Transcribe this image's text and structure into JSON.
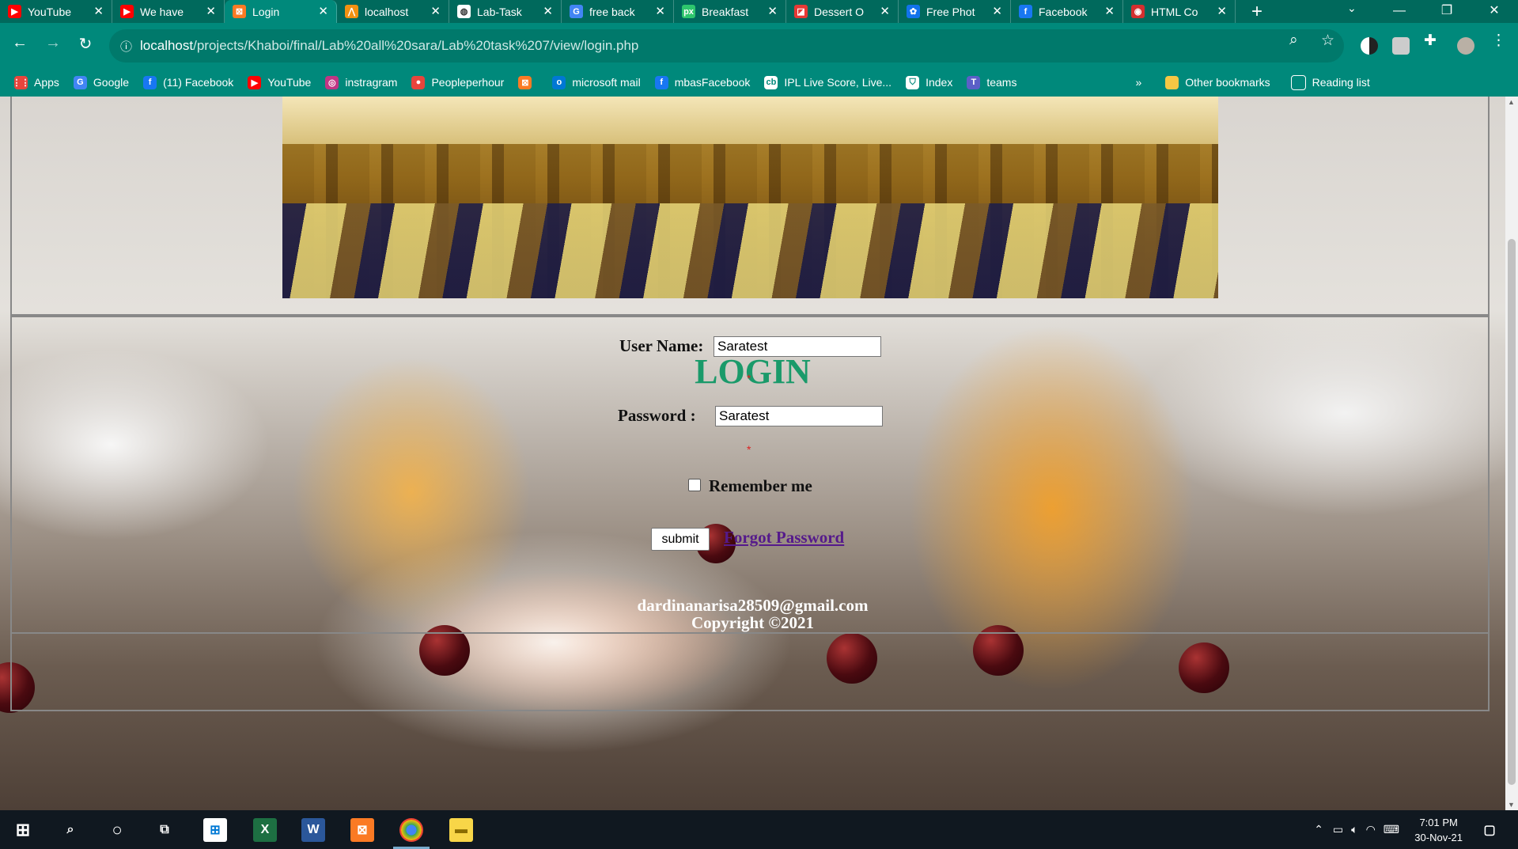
{
  "browser": {
    "tabs": [
      {
        "label": "YouTube",
        "icon": "youtube-icon",
        "color": "#ff0000",
        "glyph": "▶"
      },
      {
        "label": "We have",
        "icon": "youtube-icon",
        "color": "#ff0000",
        "glyph": "▶"
      },
      {
        "label": "Login",
        "icon": "xampp-icon",
        "color": "#fb7a24",
        "glyph": "⊠",
        "active": true
      },
      {
        "label": "localhost",
        "icon": "phpmyadmin-icon",
        "color": "#f29111",
        "glyph": "⋀"
      },
      {
        "label": "Lab-Task",
        "icon": "globe-icon",
        "color": "#ffffff",
        "glyph": "◍"
      },
      {
        "label": "free back",
        "icon": "google-icon",
        "color": "#4285f4",
        "glyph": "G"
      },
      {
        "label": "Breakfast",
        "icon": "pixabay-icon",
        "color": "#2ec66d",
        "glyph": "px"
      },
      {
        "label": "Dessert O",
        "icon": "dessert-site-icon",
        "color": "#e53935",
        "glyph": "◪"
      },
      {
        "label": "Free Phot",
        "icon": "freepik-icon",
        "color": "#1273eb",
        "glyph": "✿"
      },
      {
        "label": "Facebook",
        "icon": "facebook-icon",
        "color": "#1877f2",
        "glyph": "f"
      },
      {
        "label": "HTML Co",
        "icon": "html-site-icon",
        "color": "#d32f2f",
        "glyph": "◉"
      }
    ],
    "url_host": "localhost",
    "url_path": "/projects/Khaboi/final/Lab%20all%20sara/Lab%20task%207/view/login.php",
    "bookmarks": [
      {
        "label": "Apps",
        "icon": "apps-grid-icon",
        "color": "#e8453c",
        "glyph": "⋮⋮"
      },
      {
        "label": "Google",
        "icon": "google-icon",
        "color": "#4285f4",
        "glyph": "G"
      },
      {
        "label": "(11) Facebook",
        "icon": "facebook-icon",
        "color": "#1877f2",
        "glyph": "f"
      },
      {
        "label": "YouTube",
        "icon": "youtube-icon",
        "color": "#ff0000",
        "glyph": "▶"
      },
      {
        "label": "instragram",
        "icon": "instagram-icon",
        "color": "#c13584",
        "glyph": "◎"
      },
      {
        "label": "Peopleperhour",
        "icon": "peopleperhour-icon",
        "color": "#e8453c",
        "glyph": "●"
      },
      {
        "label": "",
        "icon": "xampp-icon",
        "color": "#fb7a24",
        "glyph": "⊠"
      },
      {
        "label": "microsoft mail",
        "icon": "outlook-icon",
        "color": "#0078d4",
        "glyph": "o"
      },
      {
        "label": "mbasFacebook",
        "icon": "facebook-icon",
        "color": "#1877f2",
        "glyph": "f"
      },
      {
        "label": "IPL Live Score, Live...",
        "icon": "cricket-icon",
        "color": "#ffffff",
        "glyph": "cb"
      },
      {
        "label": "Index",
        "icon": "shield-icon",
        "color": "#ffffff",
        "glyph": "⛉"
      },
      {
        "label": "teams",
        "icon": "teams-icon",
        "color": "#5b5fc7",
        "glyph": "T"
      }
    ],
    "more_bookmarks": "»",
    "other_bookmarks": "Other bookmarks",
    "reading_list": "Reading list"
  },
  "page": {
    "login_title": "LOGIN",
    "username_label": "User Name:",
    "username_value": "Saratest",
    "password_label": "Password :",
    "password_value": "Saratest",
    "required_mark": "*",
    "remember_label": "Remember me",
    "remember_checked": false,
    "submit_label": "submit",
    "forgot_label": "Forgot Password",
    "footer_email": "dardinanarisa28509@gmail.com",
    "footer_copyright": "Copyright ©2021"
  },
  "taskbar": {
    "time": "7:01 PM",
    "date": "30-Nov-21"
  },
  "colors": {
    "browser_chrome": "#00897b",
    "login_title": "#1a9a6a",
    "forgot_link": "#551a8b"
  }
}
